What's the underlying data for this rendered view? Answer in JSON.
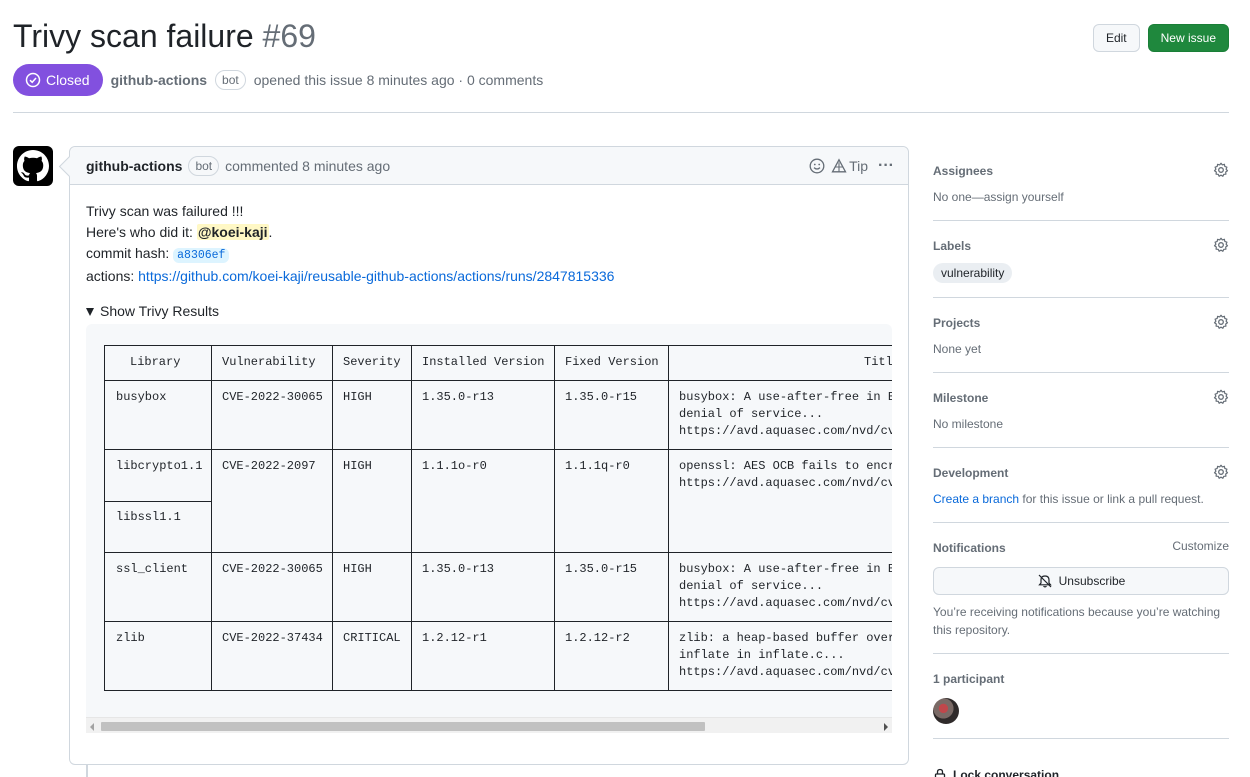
{
  "issue": {
    "title": "Trivy scan failure",
    "number": "#69",
    "state": "Closed",
    "state_color": "#8250df",
    "author": "github-actions",
    "author_badge": "bot",
    "opened_text": "opened this issue 8 minutes ago · 0 comments"
  },
  "header_actions": {
    "edit_label": "Edit",
    "new_issue_label": "New issue"
  },
  "comment": {
    "author": "github-actions",
    "badge": "bot",
    "meta": "commented 8 minutes ago",
    "tip_label": "Tip",
    "more_label": "···",
    "line1": "Trivy scan was failured !!!",
    "line2_prefix": "Here's who did it: ",
    "mention": "@koei-kaji",
    "line2_suffix": ".",
    "line3_prefix": "commit hash: ",
    "commit_hash": "a8306ef",
    "line4_prefix": "actions: ",
    "actions_url": "https://github.com/koei-kaji/reusable-github-actions/actions/runs/2847815336",
    "details_summary": "Show Trivy Results",
    "table": {
      "headers": [
        "Library",
        "Vulnerability",
        "Severity",
        "Installed Version",
        "Fixed Version",
        "Titl"
      ],
      "rows": [
        {
          "library": "busybox",
          "vuln": "CVE-2022-30065",
          "severity": "HIGH",
          "installed": "1.35.0-r13",
          "fixed": "1.35.0-r15",
          "title": [
            "busybox: A use-after-free in B",
            "denial of service...",
            "https://avd.aquasec.com/nvd/cv"
          ]
        },
        {
          "library": "libcrypto1.1",
          "library2": "libssl1.1",
          "vuln": "CVE-2022-2097",
          "severity": "HIGH",
          "installed": "1.1.1o-r0",
          "fixed": "1.1.1q-r0",
          "title": [
            "openssl: AES OCB fails to encr",
            "https://avd.aquasec.com/nvd/cv"
          ]
        },
        {
          "library": "ssl_client",
          "vuln": "CVE-2022-30065",
          "severity": "HIGH",
          "installed": "1.35.0-r13",
          "fixed": "1.35.0-r15",
          "title": [
            "busybox: A use-after-free in B",
            "denial of service...",
            "https://avd.aquasec.com/nvd/cv"
          ]
        },
        {
          "library": "zlib",
          "vuln": "CVE-2022-37434",
          "severity": "CRITICAL",
          "installed": "1.2.12-r1",
          "fixed": "1.2.12-r2",
          "title": [
            "zlib: a heap-based buffer over",
            "inflate in inflate.c...",
            "https://avd.aquasec.com/nvd/cv"
          ]
        }
      ]
    }
  },
  "sidebar": {
    "assignees": {
      "title": "Assignees",
      "value": "No one—assign yourself"
    },
    "labels": {
      "title": "Labels",
      "label": "vulnerability"
    },
    "projects": {
      "title": "Projects",
      "value": "None yet"
    },
    "milestone": {
      "title": "Milestone",
      "value": "No milestone"
    },
    "development": {
      "title": "Development",
      "link": "Create a branch",
      "suffix": " for this issue or link a pull request."
    },
    "notifications": {
      "title": "Notifications",
      "customize": "Customize",
      "unsubscribe": "Unsubscribe",
      "note": "You’re receiving notifications because you’re watching this repository."
    },
    "participants": {
      "title": "1 participant"
    },
    "lock": "Lock conversation"
  }
}
